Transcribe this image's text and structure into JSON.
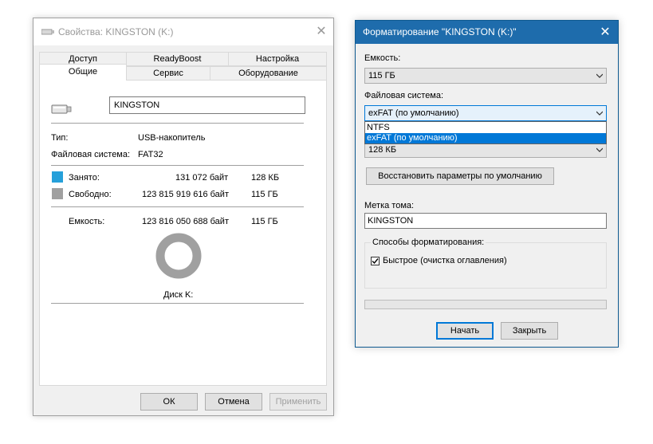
{
  "properties": {
    "title": "Свойства: KINGSTON (K:)",
    "tabs_row1": [
      "Доступ",
      "ReadyBoost",
      "Настройка"
    ],
    "tabs_row2": [
      "Общие",
      "Сервис",
      "Оборудование"
    ],
    "active_tab": "Общие",
    "volume_label": "KINGSTON",
    "type_label": "Тип:",
    "type_value": "USB-накопитель",
    "fs_label": "Файловая система:",
    "fs_value": "FAT32",
    "used_label": "Занято:",
    "used_bytes": "131 072 байт",
    "used_short": "128 КБ",
    "used_color": "#26a0da",
    "free_label": "Свободно:",
    "free_bytes": "123 815 919 616 байт",
    "free_short": "115 ГБ",
    "free_color": "#a0a0a0",
    "capacity_label": "Емкость:",
    "capacity_bytes": "123 816 050 688 байт",
    "capacity_short": "115 ГБ",
    "disk_label": "Диск K:",
    "used_fraction": 1e-06,
    "buttons": {
      "ok": "ОК",
      "cancel": "Отмена",
      "apply": "Применить"
    }
  },
  "format": {
    "title": "Форматирование \"KINGSTON (K:)\"",
    "capacity_label": "Емкость:",
    "capacity_value": "115 ГБ",
    "fs_label": "Файловая система:",
    "fs_value": "exFAT (по умолчанию)",
    "fs_options": [
      "NTFS",
      "exFAT (по умолчанию)"
    ],
    "fs_selected_index": 1,
    "cluster_value": "128 КБ",
    "restore_button": "Восстановить параметры по умолчанию",
    "volume_label_label": "Метка тома:",
    "volume_label_value": "KINGSTON",
    "format_options_label": "Способы форматирования:",
    "quick_format_label": "Быстрое (очистка оглавления)",
    "quick_format_checked": true,
    "progress": 0,
    "buttons": {
      "start": "Начать",
      "close": "Закрыть"
    },
    "accent_color": "#1e6cac"
  }
}
